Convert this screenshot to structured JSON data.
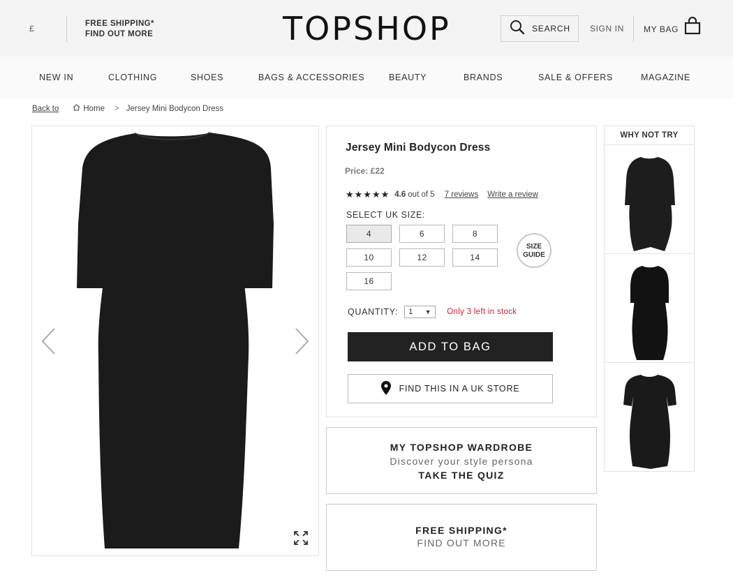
{
  "header": {
    "currency": "£",
    "shipping_line1": "FREE SHIPPING*",
    "shipping_line2": "FIND OUT MORE",
    "logo": "TOPSHOP",
    "search_label": "SEARCH",
    "signin_label": "SIGN IN",
    "bag_label": "MY BAG"
  },
  "nav": {
    "items": [
      "NEW IN",
      "CLOTHING",
      "SHOES",
      "BAGS & ACCESSORIES",
      "BEAUTY",
      "BRANDS",
      "SALE & OFFERS",
      "MAGAZINE"
    ]
  },
  "breadcrumb": {
    "back": "Back to",
    "home": "Home",
    "separator": ">",
    "current": "Jersey Mini Bodycon Dress"
  },
  "product": {
    "title": "Jersey Mini Bodycon Dress",
    "price": "Price: £22",
    "stars": "★★★★★",
    "rating_value": 4.6,
    "rating_score": "4.6",
    "rating_suffix": "out of 5",
    "reviews_link": "7 reviews",
    "write_review_link": "Write a review",
    "select_size_label": "SELECT UK SIZE:",
    "sizes": [
      "4",
      "6",
      "8",
      "10",
      "12",
      "14",
      "16"
    ],
    "selected_size": "4",
    "size_guide_line1": "SIZE",
    "size_guide_line2": "GUIDE",
    "quantity_label": "QUANTITY:",
    "quantity_value": "1",
    "stock_note": "Only 3 left in stock",
    "add_to_bag": "ADD TO BAG",
    "find_in_store": "FIND THIS IN A UK STORE"
  },
  "promos": {
    "wardrobe_title": "MY TOPSHOP WARDROBE",
    "wardrobe_sub": "Discover your style persona",
    "wardrobe_cta": "TAKE THE QUIZ",
    "shipping_title": "FREE SHIPPING*",
    "shipping_sub": "FIND OUT MORE"
  },
  "why_not_try": {
    "heading": "WHY NOT TRY"
  },
  "colors": {
    "accent": "#222222",
    "stock_warning": "#d0202a",
    "header_bg": "#f4f4f4"
  },
  "icons": [
    "search-icon",
    "bag-icon",
    "home-icon",
    "chevron-left-icon",
    "chevron-right-icon",
    "expand-icon",
    "location-pin-icon",
    "dropdown-arrow-icon"
  ]
}
